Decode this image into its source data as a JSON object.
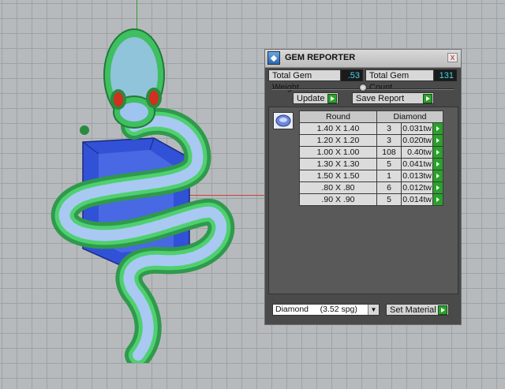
{
  "panel": {
    "title": "GEM REPORTER",
    "close_glyph": "x",
    "total_weight_label": "Total Gem Weight",
    "total_weight_value": ".53",
    "total_count_label": "Total Gem Count",
    "total_count_value": "131",
    "update_label": "Update",
    "save_report_label": "Save Report",
    "table": {
      "headers": [
        "Round",
        "Diamond"
      ],
      "rows": [
        {
          "size": "1.40 X 1.40",
          "count": "3",
          "weight": "0.031tw"
        },
        {
          "size": "1.20 X 1.20",
          "count": "3",
          "weight": "0.020tw"
        },
        {
          "size": "1.00 X 1.00",
          "count": "108",
          "weight": "0.40tw"
        },
        {
          "size": "1.30 X 1.30",
          "count": "5",
          "weight": "0.041tw"
        },
        {
          "size": "1.50 X 1.50",
          "count": "1",
          "weight": "0.013tw"
        },
        {
          "size": ".80 X .80",
          "count": "6",
          "weight": "0.012tw"
        },
        {
          "size": ".90 X .90",
          "count": "5",
          "weight": "0.014tw"
        }
      ]
    },
    "material_selected": "Diamond     (3.52 spg)",
    "set_material_label": "Set Material"
  },
  "icons": {
    "app": "gem-reporter-app-icon",
    "play": "green-arrow-right-icon",
    "gem_thumb": "round-gem-icon",
    "dropdown": "chevron-down-icon"
  },
  "colors": {
    "panel_bg": "#4a4a4a",
    "value_text": "#40d8f0",
    "go_button": "#2aa12a",
    "model_green": "#3fbf60",
    "model_stone": "#2f4fd8",
    "model_gems": "#a8c8f0",
    "model_eyes": "#d03020"
  }
}
